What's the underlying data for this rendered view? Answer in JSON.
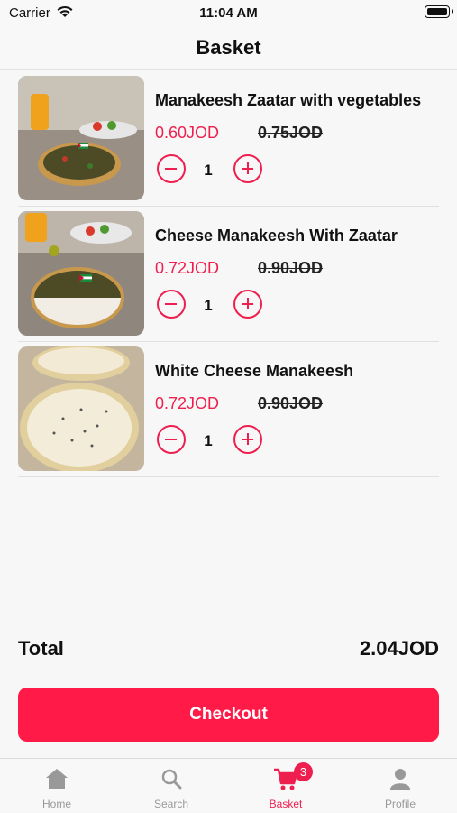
{
  "status_bar": {
    "carrier": "Carrier",
    "time": "11:04 AM"
  },
  "header": {
    "title": "Basket"
  },
  "basket": {
    "items": [
      {
        "name": "Manakeesh Zaatar with vegetables",
        "price": "0.60JOD",
        "old_price": "0.75JOD",
        "quantity": "1"
      },
      {
        "name": "Cheese Manakeesh With Zaatar",
        "price": "0.72JOD",
        "old_price": "0.90JOD",
        "quantity": "1"
      },
      {
        "name": "White Cheese Manakeesh",
        "price": "0.72JOD",
        "old_price": "0.90JOD",
        "quantity": "1"
      }
    ],
    "total_label": "Total",
    "total_value": "2.04JOD",
    "checkout_label": "Checkout"
  },
  "tab_bar": {
    "tabs": [
      {
        "label": "Home",
        "icon": "home-icon"
      },
      {
        "label": "Search",
        "icon": "search-icon"
      },
      {
        "label": "Basket",
        "icon": "cart-icon",
        "badge": "3",
        "active": true
      },
      {
        "label": "Profile",
        "icon": "person-icon"
      }
    ]
  },
  "colors": {
    "accent": "#ee1f4f",
    "checkout_bg": "#ff1a47",
    "background": "#f7f7f7"
  }
}
